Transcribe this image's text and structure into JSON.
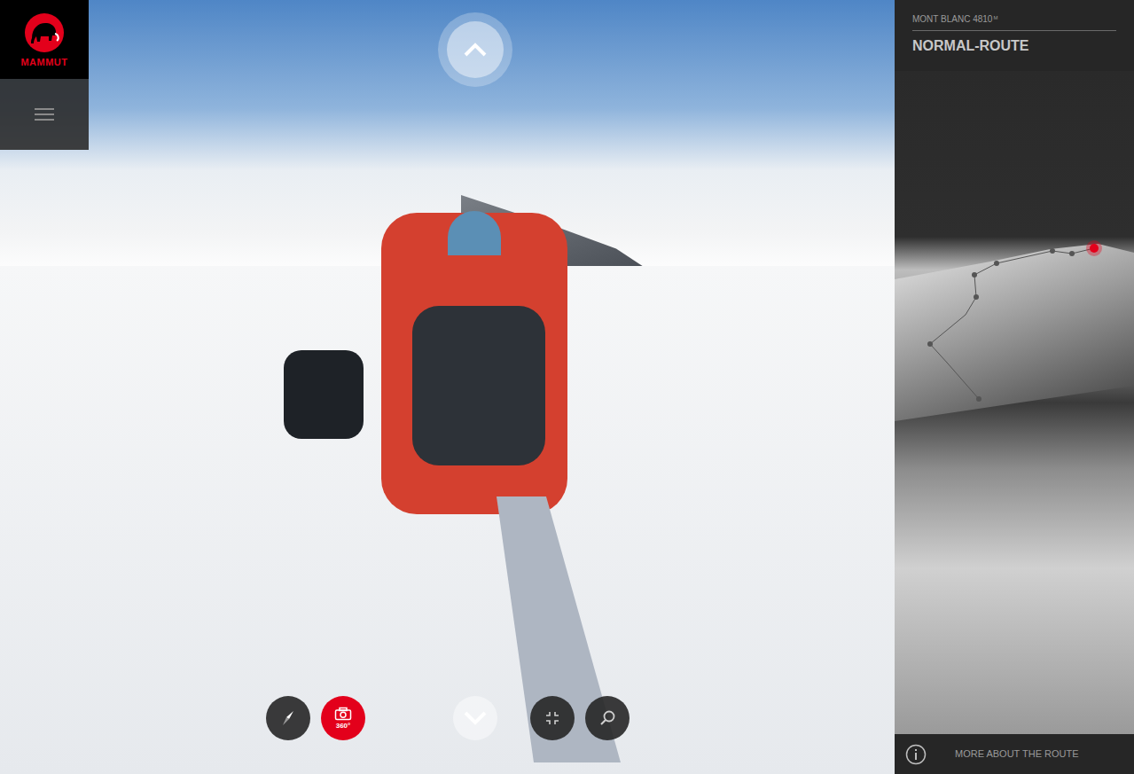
{
  "brand": {
    "name": "MAMMUT"
  },
  "viewer": {
    "up": {
      "kind": "up"
    },
    "controls": [
      {
        "kind": "compass",
        "selected": false
      },
      {
        "kind": "camera",
        "label": "360°",
        "selected": true
      },
      {
        "kind": "down",
        "selected": false
      },
      {
        "kind": "fullscreen",
        "selected": false
      },
      {
        "kind": "search",
        "selected": false
      }
    ]
  },
  "route_panel": {
    "mountain": "MONT BLANC 4810",
    "unit": "M",
    "route": "NORMAL-ROUTE",
    "footer": "MORE ABOUT THE ROUTE"
  }
}
